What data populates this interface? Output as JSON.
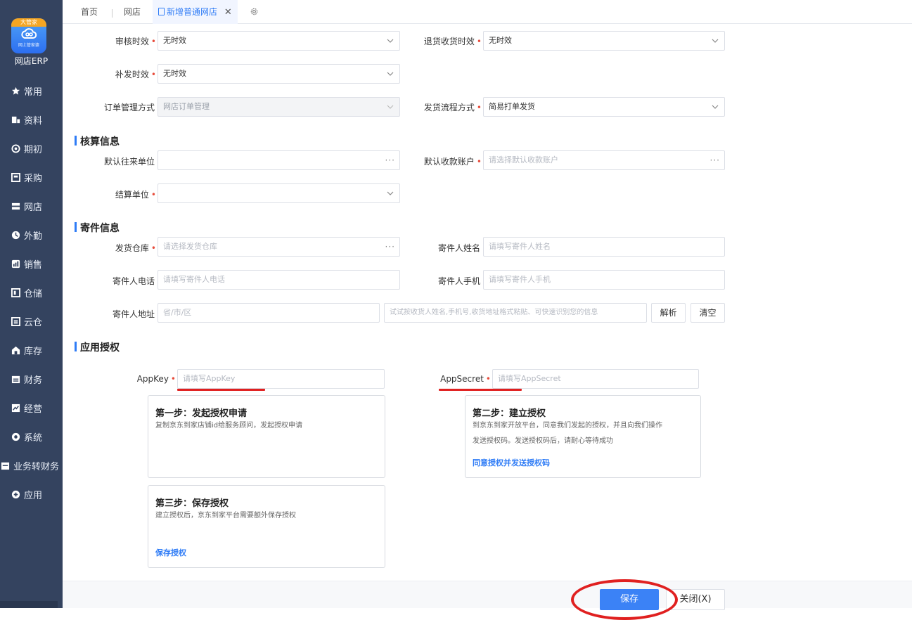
{
  "sidebar": {
    "logo_badge": "大管家",
    "logo_sub": "网上管家婆",
    "app_name": "网店ERP",
    "items": [
      {
        "label": "常用",
        "icon": "star-icon"
      },
      {
        "label": "资料",
        "icon": "data-icon"
      },
      {
        "label": "期初",
        "icon": "target-icon"
      },
      {
        "label": "采购",
        "icon": "purchase-icon"
      },
      {
        "label": "网店",
        "icon": "store-icon"
      },
      {
        "label": "外勤",
        "icon": "field-icon"
      },
      {
        "label": "销售",
        "icon": "sales-icon"
      },
      {
        "label": "仓储",
        "icon": "storage-icon"
      },
      {
        "label": "云仓",
        "icon": "cloud-warehouse-icon"
      },
      {
        "label": "库存",
        "icon": "inventory-icon"
      },
      {
        "label": "财务",
        "icon": "finance-icon"
      },
      {
        "label": "经营",
        "icon": "business-icon"
      },
      {
        "label": "系统",
        "icon": "system-icon"
      },
      {
        "label": "业务转财务",
        "icon": "transfer-icon"
      },
      {
        "label": "应用",
        "icon": "apps-icon"
      }
    ]
  },
  "tabs": {
    "home": "首页",
    "store": "网店",
    "active": "新增普通网店"
  },
  "form": {
    "audit_time_label": "审核时效",
    "audit_time_value": "无时效",
    "return_time_label": "退货收货时效",
    "return_time_value": "无时效",
    "reissue_time_label": "补发时效",
    "reissue_time_value": "无时效",
    "order_mgmt_label": "订单管理方式",
    "order_mgmt_value": "网店订单管理",
    "ship_flow_label": "发货流程方式",
    "ship_flow_value": "简易打单发货"
  },
  "settlement": {
    "section_title": "核算信息",
    "default_unit_label": "默认往来单位",
    "default_account_label": "默认收款账户",
    "default_account_placeholder": "请选择默认收款账户",
    "settle_unit_label": "结算单位"
  },
  "shipping": {
    "section_title": "寄件信息",
    "warehouse_label": "发货仓库",
    "warehouse_placeholder": "请选择发货仓库",
    "sender_name_label": "寄件人姓名",
    "sender_name_placeholder": "请填写寄件人姓名",
    "sender_phone_label": "寄件人电话",
    "sender_phone_placeholder": "请填写寄件人电话",
    "sender_mobile_label": "寄件人手机",
    "sender_mobile_placeholder": "请填写寄件人手机",
    "sender_address_label": "寄件人地址",
    "region_placeholder": "省/市/区",
    "paste_placeholder": "试试按收货人姓名,手机号,收货地址格式粘贴、可快速识别您的信息",
    "parse_button": "解析",
    "clear_button": "清空"
  },
  "auth": {
    "section_title": "应用授权",
    "appkey_label": "AppKey",
    "appkey_placeholder": "请填写AppKey",
    "appsecret_label": "AppSecret",
    "appsecret_placeholder": "请填写AppSecret",
    "step1_title": "第一步：发起授权申请",
    "step1_text": "复制京东到家店铺id给服务顾问，发起授权申请",
    "step2_title": "第二步：建立授权",
    "step2_text1": "到京东到家开放平台，同意我们发起的授权，并且向我们操作",
    "step2_text2": "发送授权码。发送授权码后，请耐心等待成功",
    "step2_link": "同意授权并发送授权码",
    "step3_title": "第三步：保存授权",
    "step3_text": "建立授权后，京东到家平台需要额外保存授权",
    "step3_link": "保存授权"
  },
  "footer": {
    "save_button": "保存",
    "close_button": "关闭(X)"
  },
  "colors": {
    "accent": "#2f7cf6",
    "sidebar": "#34435f",
    "required": "#e74c3c",
    "annotation": "#e02020"
  }
}
